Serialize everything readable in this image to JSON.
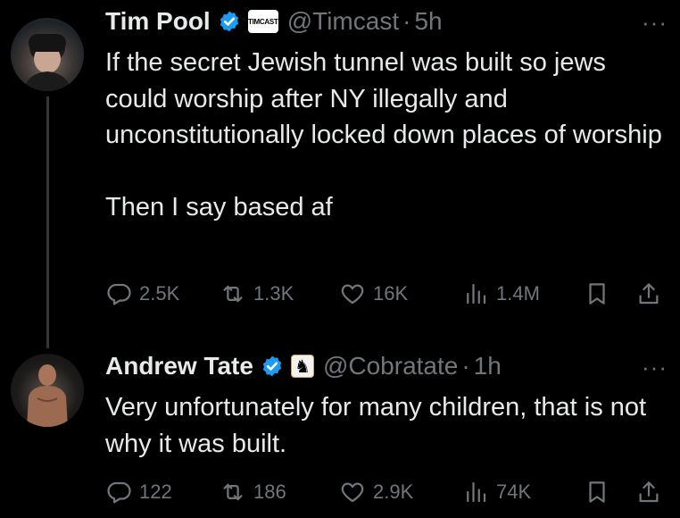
{
  "tweets": [
    {
      "name": "Tim Pool",
      "affiliate_label": "TIMCAST",
      "handle": "@Timcast",
      "separator": "·",
      "time": "5h",
      "more": "···",
      "text_paragraphs": [
        "If the secret Jewish tunnel was built so jews could worship after NY illegally and unconstitutionally locked down places of worship",
        "Then I say based af"
      ],
      "stats": {
        "replies": "2.5K",
        "reposts": "1.3K",
        "likes": "16K",
        "views": "1.4M"
      }
    },
    {
      "name": "Andrew Tate",
      "affiliate_label": "♞",
      "handle": "@Cobratate",
      "separator": "·",
      "time": "1h",
      "more": "···",
      "text_paragraphs": [
        "Very unfortunately for many children, that is not why it was built."
      ],
      "stats": {
        "replies": "122",
        "reposts": "186",
        "likes": "2.9K",
        "views": "74K"
      }
    }
  ],
  "icons": {
    "verified": "verified-badge-icon",
    "reply": "reply-icon",
    "repost": "repost-icon",
    "like": "heart-icon",
    "views": "views-icon",
    "bookmark": "bookmark-icon",
    "share": "share-icon"
  },
  "colors": {
    "background": "#000000",
    "text": "#e7e9ea",
    "secondary": "#71767b",
    "verified": "#1d9bf0"
  }
}
